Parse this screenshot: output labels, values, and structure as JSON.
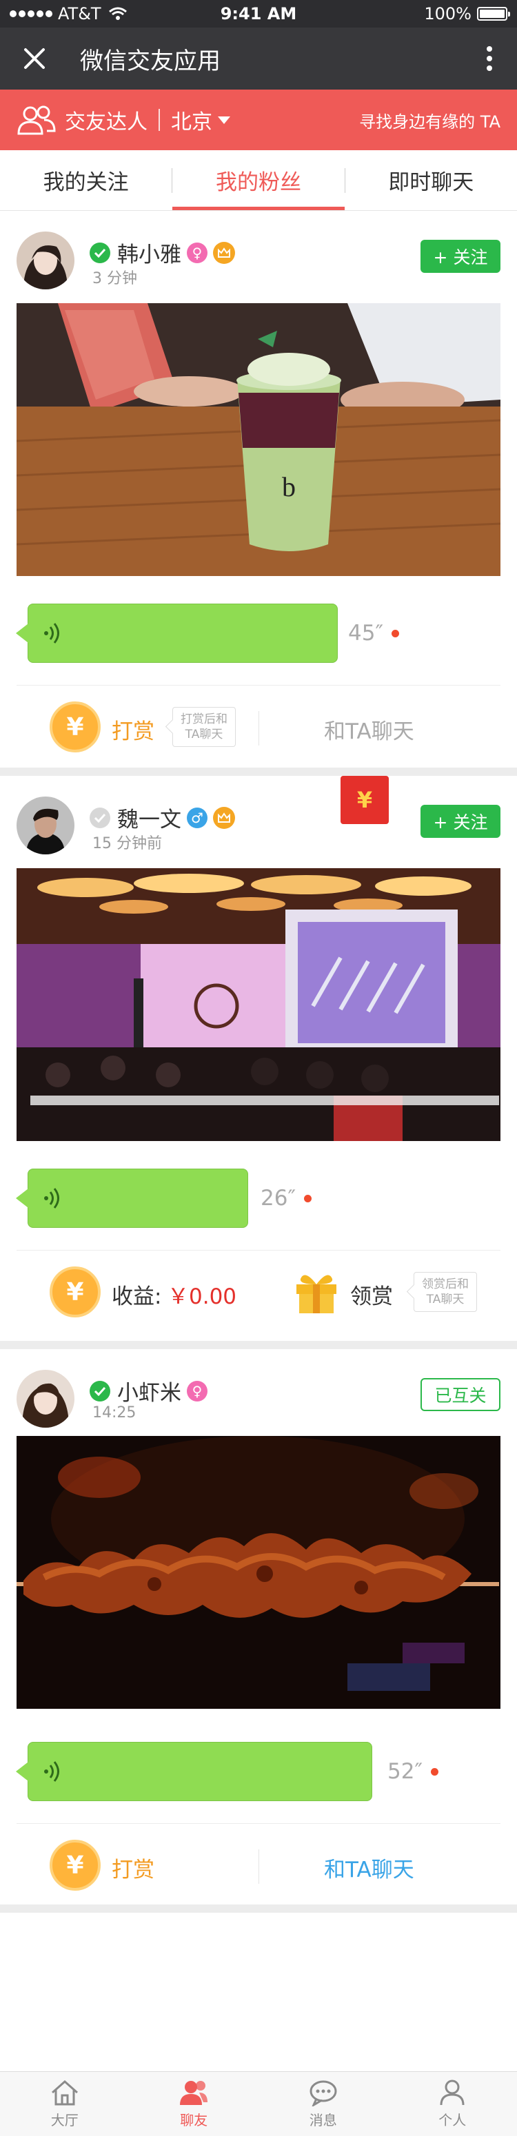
{
  "status_bar": {
    "carrier": "AT&T",
    "time": "9:41 AM",
    "battery": "100%"
  },
  "nav": {
    "title": "微信交友应用",
    "close_icon": "close-icon",
    "more_icon": "more-vertical-icon"
  },
  "banner": {
    "title": "交友达人",
    "city": "北京",
    "hint": "寻找身边有缘的 TA",
    "color": "#ef5a57"
  },
  "tabs": [
    {
      "label": "我的关注",
      "active": false
    },
    {
      "label": "我的粉丝",
      "active": true
    },
    {
      "label": "即时聊天",
      "active": false
    }
  ],
  "posts": [
    {
      "name": "韩小雅",
      "time": "3 分钟",
      "gender": "♀",
      "verified": true,
      "vip": true,
      "follow_label": "+ 关注",
      "voice_duration": "45″",
      "reward_label": "打赏",
      "reward_tip": [
        "打赏后和",
        "TA聊天"
      ],
      "chat_label": "和TA聊天"
    },
    {
      "name": "魏一文",
      "time": "15 分钟前",
      "gender": "♂",
      "verified": false,
      "vip": true,
      "follow_label": "+ 关注",
      "red_packet": "¥",
      "voice_duration": "26″",
      "income_label": "收益:",
      "income_value": "￥0.00",
      "claim_label": "领赏",
      "claim_tip": [
        "领赏后和",
        "TA聊天"
      ]
    },
    {
      "name": "小虾米",
      "time": "14:25",
      "gender": "♀",
      "verified": true,
      "vip": false,
      "follow_label": "已互关",
      "voice_duration": "52″",
      "reward_label": "打赏",
      "chat_label": "和TA聊天"
    }
  ],
  "bottom_tabs": [
    {
      "label": "大厅",
      "icon": "home-icon",
      "active": false
    },
    {
      "label": "聊友",
      "icon": "chat-friends-icon",
      "active": true
    },
    {
      "label": "消息",
      "icon": "message-icon",
      "active": false
    },
    {
      "label": "个人",
      "icon": "profile-icon",
      "active": false
    }
  ]
}
